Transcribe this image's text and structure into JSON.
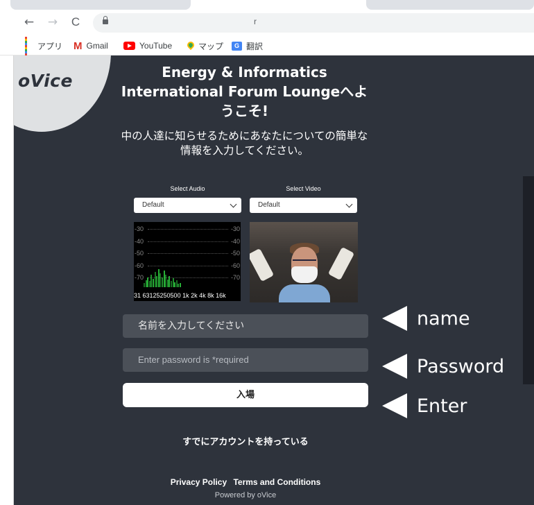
{
  "browser": {
    "url": "r",
    "back_glyph": "←",
    "forward_glyph": "→",
    "reload_glyph": "C",
    "bookmarks": [
      {
        "label": "アプリ",
        "icon": "apps-grid-icon"
      },
      {
        "label": "Gmail",
        "icon": "gmail-icon",
        "glyph": "M"
      },
      {
        "label": "YouTube",
        "icon": "youtube-icon"
      },
      {
        "label": "マップ",
        "icon": "maps-pin-icon"
      },
      {
        "label": "翻訳",
        "icon": "translate-icon",
        "glyph": "G"
      }
    ]
  },
  "logo": "oVice",
  "title": "Energy & Informatics International Forum Loungeへようこそ!",
  "subtitle": "中の人達に知らせるためにあなたについての簡単な情報を入力してください。",
  "media": {
    "audio_label": "Select Audio",
    "audio_value": "Default",
    "video_label": "Select Video",
    "video_value": "Default",
    "meter_levels": [
      {
        "left": "-30",
        "right": "-30"
      },
      {
        "left": "-40",
        "right": "-40"
      },
      {
        "left": "-50",
        "right": "-50"
      },
      {
        "left": "-60",
        "right": "-60"
      },
      {
        "left": "-70",
        "right": "-70"
      }
    ],
    "meter_freq": "31 63125250500 1k 2k 4k 8k 16k"
  },
  "form": {
    "name_placeholder": "名前を入力してください",
    "password_placeholder": "Enter password is *required",
    "enter_label": "入場",
    "account_link": "すでにアカウントを持っている"
  },
  "footer": {
    "privacy": "Privacy Policy",
    "terms": "Terms and Conditions",
    "powered": "Powered by oVice"
  },
  "annotations": {
    "name": "name",
    "password": "Password",
    "enter": "Enter"
  },
  "colors": {
    "page_bg": "#2e333c",
    "field_bg": "#4b5058",
    "logo_bg": "#dfe1e3"
  }
}
